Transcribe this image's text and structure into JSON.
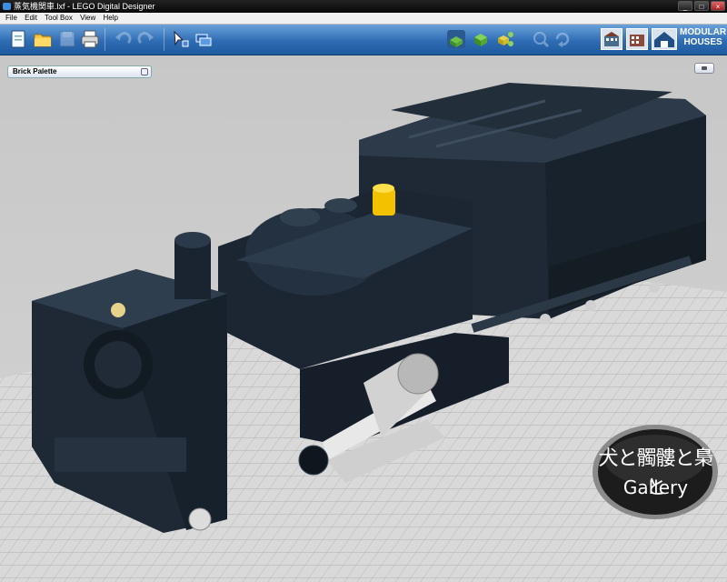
{
  "window": {
    "title": "蒸気機関車.lxf - LEGO Digital Designer"
  },
  "window_controls": [
    "_",
    "□",
    "×"
  ],
  "menu": [
    "File",
    "Edit",
    "Tool Box",
    "View",
    "Help"
  ],
  "toolbar": {
    "brand_line1": "MODULAR",
    "brand_line2": "HOUSES"
  },
  "palette": {
    "title": "Brick Palette"
  },
  "badge": {
    "line1": "犬と髑髏と梟と",
    "line2": "Gallery"
  },
  "colors": {
    "toolbar": "#2e6cb4",
    "bricks": "#1b2632",
    "grey_bricks": "#d2d2d2",
    "yellow": "#f2c200"
  },
  "icons": [
    "new-file-icon",
    "open-folder-icon",
    "save-icon",
    "print-icon",
    "undo-icon",
    "redo-icon",
    "select-tool-icon",
    "clone-tool-icon",
    "build-mode-icon",
    "view-mode-icon",
    "instructions-mode-icon",
    "zoom-icon",
    "rotate-icon"
  ]
}
